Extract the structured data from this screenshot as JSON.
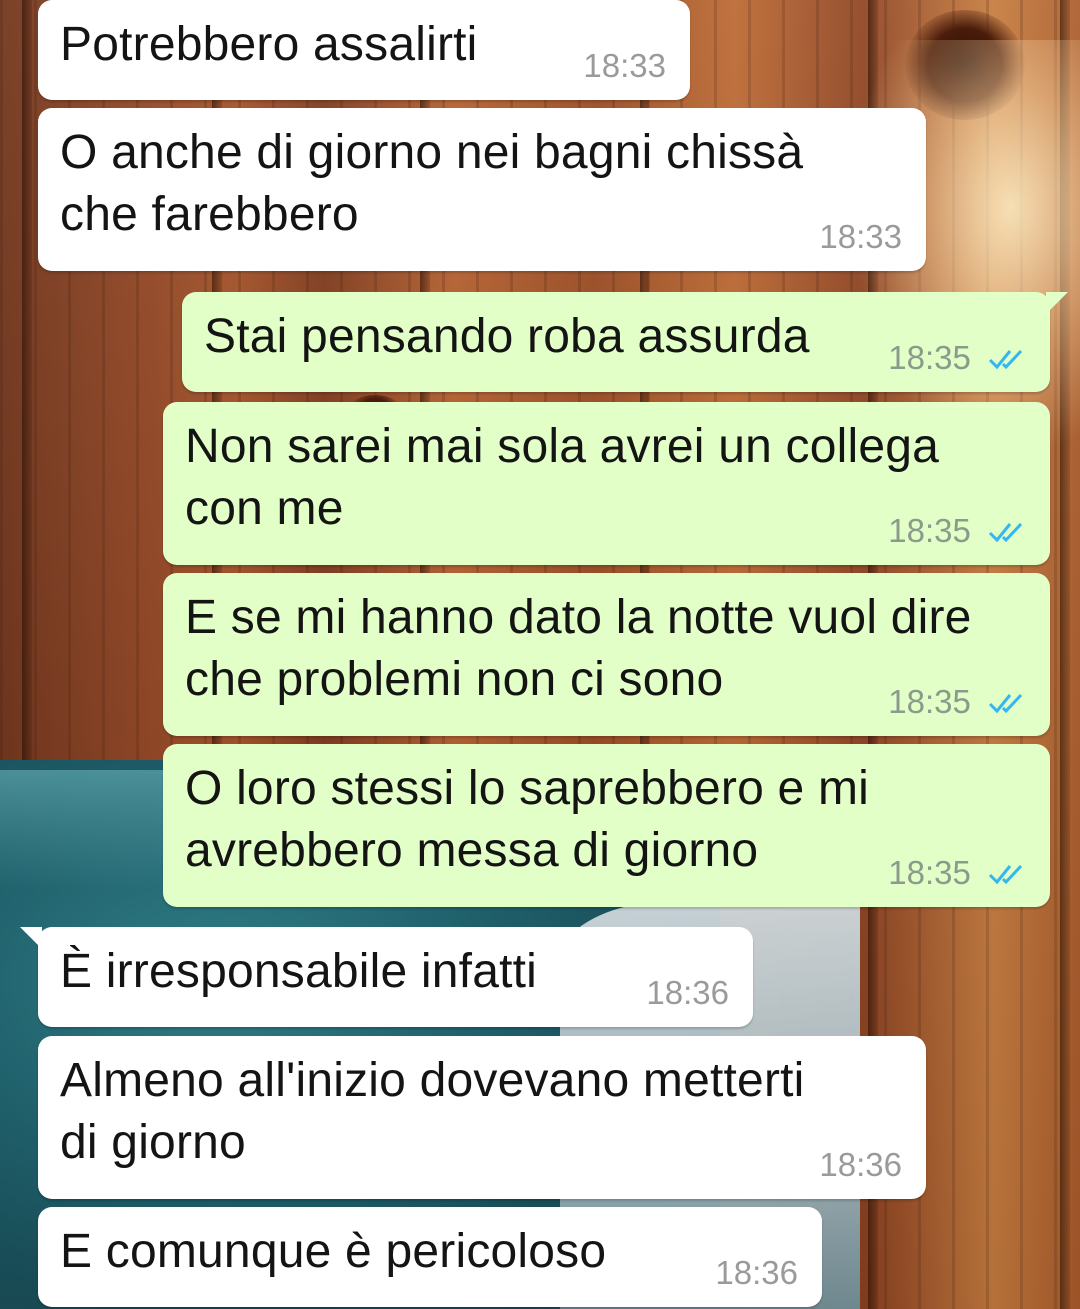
{
  "messages": [
    {
      "direction": "incoming",
      "text_lines": [
        "Potrebbero assalirti"
      ],
      "time": "18:33"
    },
    {
      "direction": "incoming",
      "text_lines": [
        "O anche di giorno nei bagni chissà",
        "che farebbero"
      ],
      "time": "18:33"
    },
    {
      "direction": "outgoing",
      "text_lines": [
        "Stai pensando roba assurda"
      ],
      "time": "18:35",
      "status": "read-double-check"
    },
    {
      "direction": "outgoing",
      "text_lines": [
        "Non sarei mai sola avrei un collega",
        "con me"
      ],
      "time": "18:35",
      "status": "read-double-check"
    },
    {
      "direction": "outgoing",
      "text_lines": [
        "E se mi hanno dato la notte vuol dire",
        "che problemi non ci sono"
      ],
      "time": "18:35",
      "status": "read-double-check"
    },
    {
      "direction": "outgoing",
      "text_lines": [
        "O loro stessi lo saprebbero e mi",
        "avrebbero messa di giorno"
      ],
      "time": "18:35",
      "status": "read-double-check"
    },
    {
      "direction": "incoming",
      "text_lines": [
        "È irresponsabile infatti"
      ],
      "time": "18:36"
    },
    {
      "direction": "incoming",
      "text_lines": [
        "Almeno all'inizio dovevano metterti",
        "di giorno"
      ],
      "time": "18:36"
    },
    {
      "direction": "incoming",
      "text_lines": [
        "E comunque è pericoloso"
      ],
      "time": "18:36"
    }
  ],
  "colors": {
    "incoming_bubble": "#ffffff",
    "outgoing_bubble": "#e1ffc7",
    "read_tick": "#34b7f1"
  },
  "icons": {
    "read_status": "double-check-icon"
  }
}
